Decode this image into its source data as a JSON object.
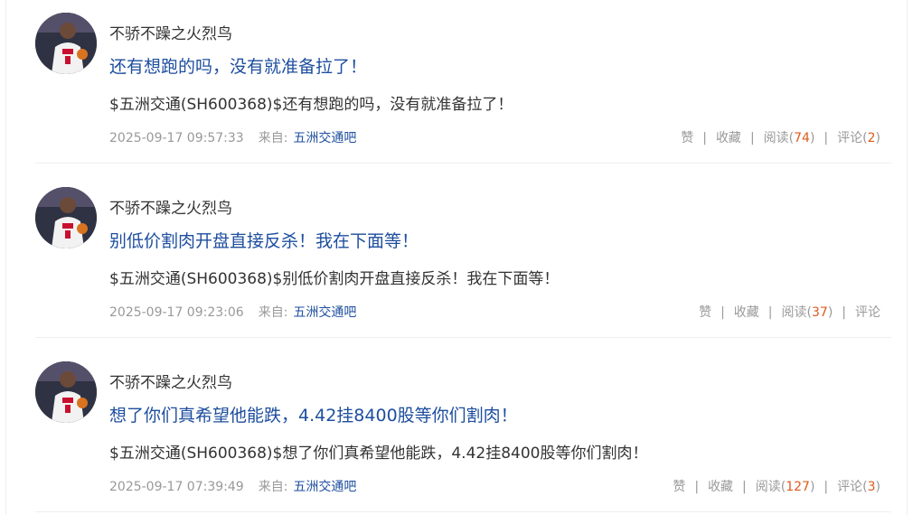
{
  "posts": [
    {
      "author": "不骄不躁之火烈鸟",
      "title": "还有想跑的吗，没有就准备拉了！",
      "content": "$五洲交通(SH600368)$还有想跑的吗，没有就准备拉了！",
      "time": "2025-09-17 09:57:33",
      "from_label": "来自:",
      "source": "五洲交通吧",
      "like": "赞",
      "favorite": "收藏",
      "read_label": "阅读",
      "read_open": "(",
      "read_count": "74",
      "read_close": ")",
      "comment_label": "评论",
      "comment_open": "(",
      "comment_count": "2",
      "comment_close": ")"
    },
    {
      "author": "不骄不躁之火烈鸟",
      "title": "别低价割肉开盘直接反杀！我在下面等！",
      "content": "$五洲交通(SH600368)$别低价割肉开盘直接反杀！我在下面等！",
      "time": "2025-09-17 09:23:06",
      "from_label": "来自:",
      "source": "五洲交通吧",
      "like": "赞",
      "favorite": "收藏",
      "read_label": "阅读",
      "read_open": "(",
      "read_count": "37",
      "read_close": ")",
      "comment_label": "评论",
      "comment_open": "",
      "comment_count": "",
      "comment_close": ""
    },
    {
      "author": "不骄不躁之火烈鸟",
      "title": "想了你们真希望他能跌，4.42挂8400股等你们割肉！",
      "content": "$五洲交通(SH600368)$想了你们真希望他能跌，4.42挂8400股等你们割肉！",
      "time": "2025-09-17 07:39:49",
      "from_label": "来自:",
      "source": "五洲交通吧",
      "like": "赞",
      "favorite": "收藏",
      "read_label": "阅读",
      "read_open": "(",
      "read_count": "127",
      "read_close": ")",
      "comment_label": "评论",
      "comment_open": "(",
      "comment_count": "3",
      "comment_close": ")"
    }
  ],
  "separator": "|",
  "colors": {
    "title": "#1d4e9f",
    "count": "#e05a1c",
    "meta": "#999999",
    "text": "#333333"
  }
}
